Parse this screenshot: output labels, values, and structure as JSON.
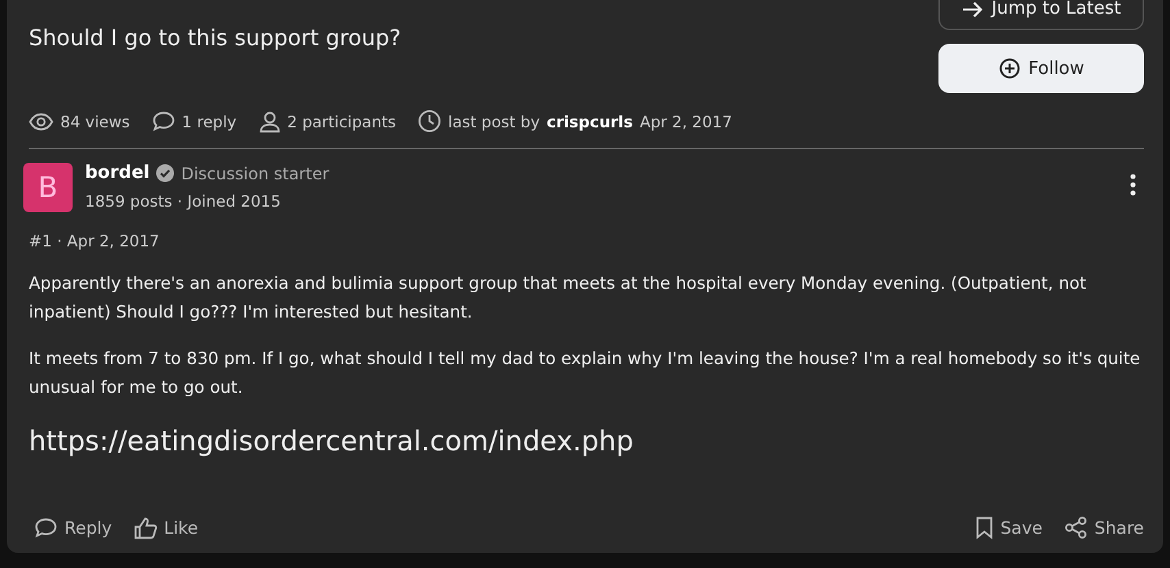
{
  "thread": {
    "title": "Should I go to this support group?",
    "jump_button": "Jump to Latest",
    "follow_button": "Follow"
  },
  "stats": [
    {
      "kind": "views",
      "text": "84 views"
    },
    {
      "kind": "replies",
      "text": "1 reply"
    },
    {
      "kind": "participants",
      "text": "2 participants"
    },
    {
      "kind": "last_post",
      "text": "last post by",
      "user": "crispcurls",
      "date": "Apr 2, 2017"
    }
  ],
  "post": {
    "avatar": {
      "letter": "B",
      "color": "#d6336c"
    },
    "author": "bordel",
    "badge": "Discussion starter",
    "author_meta": "1859 posts · Joined 2015",
    "number": "#1 · Apr 2, 2017",
    "paragraphs": [
      "Apparently there's an anorexia and bulimia support group that meets at the hospital every Monday evening. (Outpatient, not inpatient) Should I go??? I'm interested but hesitant.",
      "It meets from 7 to 830 pm. If I go, what should I tell my dad to explain why I'm leaving the house? I'm a real homebody so it's quite unusual for me to go out."
    ],
    "link": "https://eatingdisordercentral.com/index.php",
    "actions": [
      {
        "kind": "reply",
        "label": "Reply"
      },
      {
        "kind": "like",
        "label": "Like"
      },
      {
        "kind": "save",
        "label": "Save"
      },
      {
        "kind": "share",
        "label": "Share"
      }
    ]
  }
}
